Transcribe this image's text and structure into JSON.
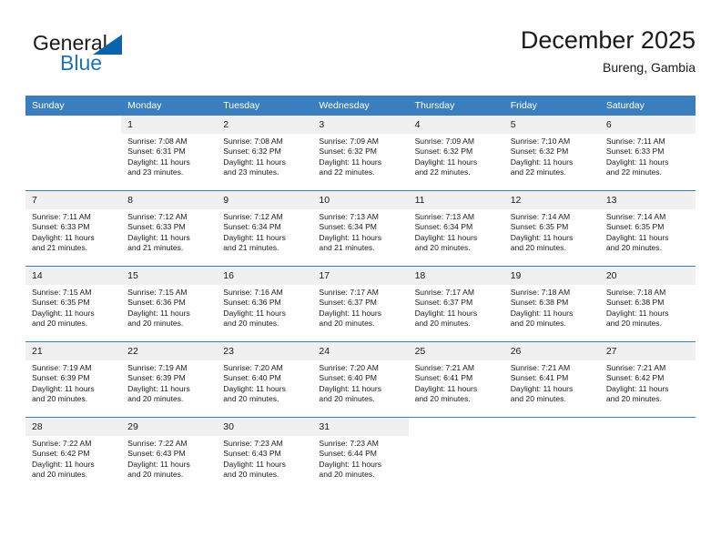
{
  "brand": {
    "word_one": "General",
    "word_two": "Blue",
    "triangle_color": "#0b62ad",
    "blue_color": "#2072b8"
  },
  "header": {
    "title": "December 2025",
    "subtitle": "Bureng, Gambia"
  },
  "theme": {
    "header_row_bg": "#3a7ec0",
    "header_row_text": "#ffffff",
    "daynum_bg": "#f0f0f0",
    "cell_bg": "#ffffff",
    "row_divider": "#3a7ec0"
  },
  "weekdays": [
    "Sunday",
    "Monday",
    "Tuesday",
    "Wednesday",
    "Thursday",
    "Friday",
    "Saturday"
  ],
  "labels": {
    "sunrise_prefix": "Sunrise: ",
    "sunset_prefix": "Sunset: ",
    "daylight_prefix": "Daylight: "
  },
  "weeks": [
    [
      {
        "empty": true
      },
      {
        "day": "1",
        "sunrise": "Sunrise: 7:08 AM",
        "sunset": "Sunset: 6:31 PM",
        "daylight_a": "Daylight: 11 hours",
        "daylight_b": "and 23 minutes."
      },
      {
        "day": "2",
        "sunrise": "Sunrise: 7:08 AM",
        "sunset": "Sunset: 6:32 PM",
        "daylight_a": "Daylight: 11 hours",
        "daylight_b": "and 23 minutes."
      },
      {
        "day": "3",
        "sunrise": "Sunrise: 7:09 AM",
        "sunset": "Sunset: 6:32 PM",
        "daylight_a": "Daylight: 11 hours",
        "daylight_b": "and 22 minutes."
      },
      {
        "day": "4",
        "sunrise": "Sunrise: 7:09 AM",
        "sunset": "Sunset: 6:32 PM",
        "daylight_a": "Daylight: 11 hours",
        "daylight_b": "and 22 minutes."
      },
      {
        "day": "5",
        "sunrise": "Sunrise: 7:10 AM",
        "sunset": "Sunset: 6:32 PM",
        "daylight_a": "Daylight: 11 hours",
        "daylight_b": "and 22 minutes."
      },
      {
        "day": "6",
        "sunrise": "Sunrise: 7:11 AM",
        "sunset": "Sunset: 6:33 PM",
        "daylight_a": "Daylight: 11 hours",
        "daylight_b": "and 22 minutes."
      }
    ],
    [
      {
        "day": "7",
        "sunrise": "Sunrise: 7:11 AM",
        "sunset": "Sunset: 6:33 PM",
        "daylight_a": "Daylight: 11 hours",
        "daylight_b": "and 21 minutes."
      },
      {
        "day": "8",
        "sunrise": "Sunrise: 7:12 AM",
        "sunset": "Sunset: 6:33 PM",
        "daylight_a": "Daylight: 11 hours",
        "daylight_b": "and 21 minutes."
      },
      {
        "day": "9",
        "sunrise": "Sunrise: 7:12 AM",
        "sunset": "Sunset: 6:34 PM",
        "daylight_a": "Daylight: 11 hours",
        "daylight_b": "and 21 minutes."
      },
      {
        "day": "10",
        "sunrise": "Sunrise: 7:13 AM",
        "sunset": "Sunset: 6:34 PM",
        "daylight_a": "Daylight: 11 hours",
        "daylight_b": "and 21 minutes."
      },
      {
        "day": "11",
        "sunrise": "Sunrise: 7:13 AM",
        "sunset": "Sunset: 6:34 PM",
        "daylight_a": "Daylight: 11 hours",
        "daylight_b": "and 20 minutes."
      },
      {
        "day": "12",
        "sunrise": "Sunrise: 7:14 AM",
        "sunset": "Sunset: 6:35 PM",
        "daylight_a": "Daylight: 11 hours",
        "daylight_b": "and 20 minutes."
      },
      {
        "day": "13",
        "sunrise": "Sunrise: 7:14 AM",
        "sunset": "Sunset: 6:35 PM",
        "daylight_a": "Daylight: 11 hours",
        "daylight_b": "and 20 minutes."
      }
    ],
    [
      {
        "day": "14",
        "sunrise": "Sunrise: 7:15 AM",
        "sunset": "Sunset: 6:35 PM",
        "daylight_a": "Daylight: 11 hours",
        "daylight_b": "and 20 minutes."
      },
      {
        "day": "15",
        "sunrise": "Sunrise: 7:15 AM",
        "sunset": "Sunset: 6:36 PM",
        "daylight_a": "Daylight: 11 hours",
        "daylight_b": "and 20 minutes."
      },
      {
        "day": "16",
        "sunrise": "Sunrise: 7:16 AM",
        "sunset": "Sunset: 6:36 PM",
        "daylight_a": "Daylight: 11 hours",
        "daylight_b": "and 20 minutes."
      },
      {
        "day": "17",
        "sunrise": "Sunrise: 7:17 AM",
        "sunset": "Sunset: 6:37 PM",
        "daylight_a": "Daylight: 11 hours",
        "daylight_b": "and 20 minutes."
      },
      {
        "day": "18",
        "sunrise": "Sunrise: 7:17 AM",
        "sunset": "Sunset: 6:37 PM",
        "daylight_a": "Daylight: 11 hours",
        "daylight_b": "and 20 minutes."
      },
      {
        "day": "19",
        "sunrise": "Sunrise: 7:18 AM",
        "sunset": "Sunset: 6:38 PM",
        "daylight_a": "Daylight: 11 hours",
        "daylight_b": "and 20 minutes."
      },
      {
        "day": "20",
        "sunrise": "Sunrise: 7:18 AM",
        "sunset": "Sunset: 6:38 PM",
        "daylight_a": "Daylight: 11 hours",
        "daylight_b": "and 20 minutes."
      }
    ],
    [
      {
        "day": "21",
        "sunrise": "Sunrise: 7:19 AM",
        "sunset": "Sunset: 6:39 PM",
        "daylight_a": "Daylight: 11 hours",
        "daylight_b": "and 20 minutes."
      },
      {
        "day": "22",
        "sunrise": "Sunrise: 7:19 AM",
        "sunset": "Sunset: 6:39 PM",
        "daylight_a": "Daylight: 11 hours",
        "daylight_b": "and 20 minutes."
      },
      {
        "day": "23",
        "sunrise": "Sunrise: 7:20 AM",
        "sunset": "Sunset: 6:40 PM",
        "daylight_a": "Daylight: 11 hours",
        "daylight_b": "and 20 minutes."
      },
      {
        "day": "24",
        "sunrise": "Sunrise: 7:20 AM",
        "sunset": "Sunset: 6:40 PM",
        "daylight_a": "Daylight: 11 hours",
        "daylight_b": "and 20 minutes."
      },
      {
        "day": "25",
        "sunrise": "Sunrise: 7:21 AM",
        "sunset": "Sunset: 6:41 PM",
        "daylight_a": "Daylight: 11 hours",
        "daylight_b": "and 20 minutes."
      },
      {
        "day": "26",
        "sunrise": "Sunrise: 7:21 AM",
        "sunset": "Sunset: 6:41 PM",
        "daylight_a": "Daylight: 11 hours",
        "daylight_b": "and 20 minutes."
      },
      {
        "day": "27",
        "sunrise": "Sunrise: 7:21 AM",
        "sunset": "Sunset: 6:42 PM",
        "daylight_a": "Daylight: 11 hours",
        "daylight_b": "and 20 minutes."
      }
    ],
    [
      {
        "day": "28",
        "sunrise": "Sunrise: 7:22 AM",
        "sunset": "Sunset: 6:42 PM",
        "daylight_a": "Daylight: 11 hours",
        "daylight_b": "and 20 minutes."
      },
      {
        "day": "29",
        "sunrise": "Sunrise: 7:22 AM",
        "sunset": "Sunset: 6:43 PM",
        "daylight_a": "Daylight: 11 hours",
        "daylight_b": "and 20 minutes."
      },
      {
        "day": "30",
        "sunrise": "Sunrise: 7:23 AM",
        "sunset": "Sunset: 6:43 PM",
        "daylight_a": "Daylight: 11 hours",
        "daylight_b": "and 20 minutes."
      },
      {
        "day": "31",
        "sunrise": "Sunrise: 7:23 AM",
        "sunset": "Sunset: 6:44 PM",
        "daylight_a": "Daylight: 11 hours",
        "daylight_b": "and 20 minutes."
      },
      {
        "empty": true
      },
      {
        "empty": true
      },
      {
        "empty": true
      }
    ]
  ]
}
